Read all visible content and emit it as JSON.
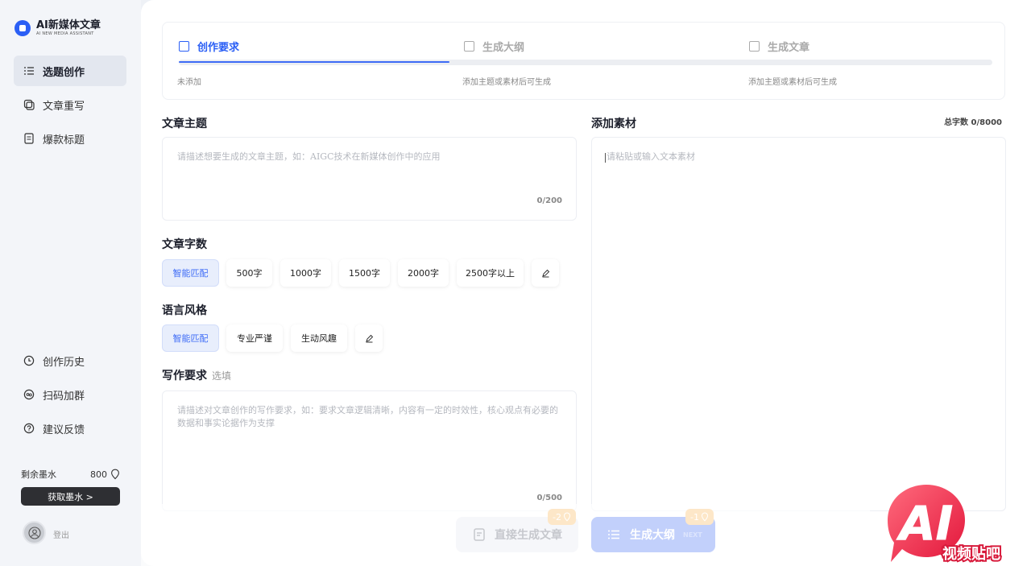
{
  "app": {
    "name": "AI新媒体文章",
    "subtitle": "AI NEW MEDIA ASSISTANT"
  },
  "sidebar": {
    "items": [
      {
        "label": "选题创作",
        "icon": "list-icon",
        "active": true
      },
      {
        "label": "文章重写",
        "icon": "rewrite-icon",
        "active": false
      },
      {
        "label": "爆款标题",
        "icon": "document-icon",
        "active": false
      }
    ],
    "bottom_items": [
      {
        "label": "创作历史",
        "icon": "clock-icon"
      },
      {
        "label": "扫码加群",
        "icon": "group-icon"
      },
      {
        "label": "建议反馈",
        "icon": "help-icon"
      }
    ],
    "ink_label": "剩余墨水",
    "ink_value": "800",
    "get_ink_button": "获取墨水 >",
    "logout": "登出"
  },
  "steps": [
    {
      "label": "创作要求",
      "sub": "未添加",
      "active": true
    },
    {
      "label": "生成大纲",
      "sub": "添加主题或素材后可生成",
      "active": false
    },
    {
      "label": "生成文章",
      "sub": "添加主题或素材后可生成",
      "active": false
    }
  ],
  "form": {
    "topic": {
      "title": "文章主题",
      "placeholder": "请描述想要生成的文章主题，如：AIGC技术在新媒体创作中的应用",
      "counter": "0/200"
    },
    "word_count": {
      "title": "文章字数",
      "options": [
        "智能匹配",
        "500字",
        "1000字",
        "1500字",
        "2000字",
        "2500字以上"
      ],
      "selected": "智能匹配"
    },
    "style": {
      "title": "语言风格",
      "options": [
        "智能匹配",
        "专业严谨",
        "生动风趣"
      ],
      "selected": "智能匹配"
    },
    "requirements": {
      "title": "写作要求",
      "optional": "选填",
      "placeholder": "请描述对文章创作的写作要求，如：要求文章逻辑清晰，内容有一定的时效性，核心观点有必要的数据和事实论据作为支撑",
      "counter": "0/500"
    },
    "material": {
      "title": "添加素材",
      "total": "总字数 0/8000",
      "placeholder": "请粘贴或输入文本素材"
    }
  },
  "actions": {
    "direct": {
      "label": "直接生成文章",
      "cost": "-2"
    },
    "outline": {
      "label": "生成大纲",
      "next": "NEXT",
      "cost": "-1"
    }
  },
  "watermark": {
    "big": "AI",
    "small": "视频贴吧"
  },
  "colors": {
    "accent": "#2b5ff5",
    "sidebar_bg": "#f3f5f9",
    "badge": "#fde7c8"
  }
}
